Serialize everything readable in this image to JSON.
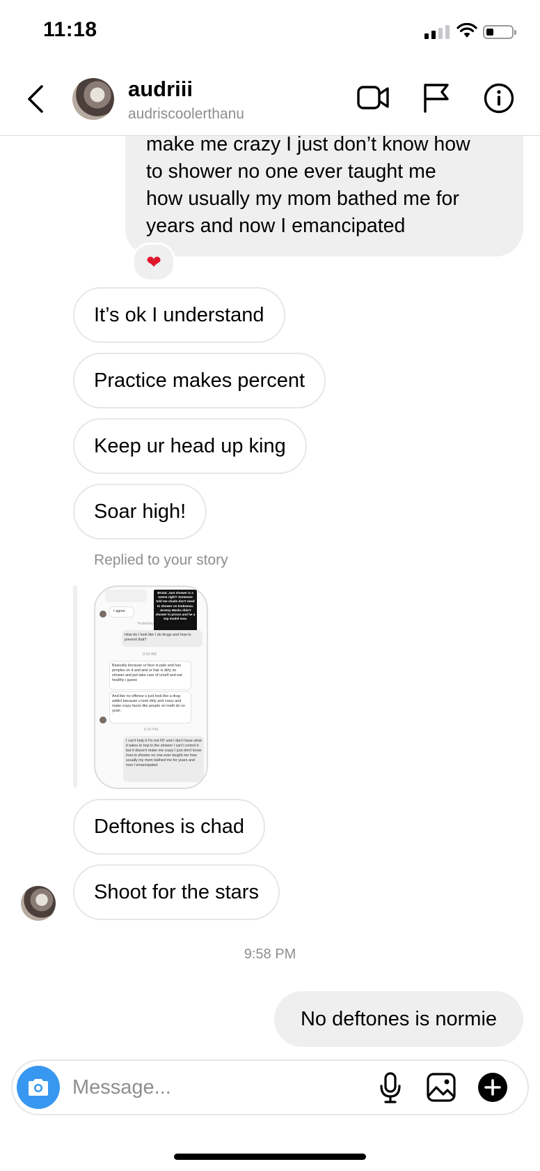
{
  "status_bar": {
    "time": "11:18"
  },
  "header": {
    "username": "audriii",
    "handle": "audriscoolerthanu"
  },
  "messages": {
    "outgoing_long_lines": [
      "make me crazy I just don’t know how",
      "to shower no one ever taught me",
      "how usually my mom bathed me for",
      "years and now I emancipated"
    ],
    "reaction": "❤",
    "incoming_group_1": [
      "It’s ok I understand",
      "Practice makes percent",
      "Keep ur head up king",
      "Soar high!"
    ],
    "story_reply_label": "Replied to your story",
    "incoming_group_2": [
      "Deftones is chad",
      "Shoot for the stars"
    ],
    "timestamp": "9:58 PM",
    "outgoing_last": "No deftones is normie"
  },
  "story_thumbnail": {
    "overlay_text": "Brutal. Just shower is a meme right? Someone told me chads don't need to shower on looksmax. Jeremy Meeks didn't shower in prison and he a top model now.",
    "msg_agree": "I agree",
    "label_yesterday": "Yesterday",
    "msg_drugs": "How do I look like I do drugs and how to prevent that?",
    "time_1": "9:55 AM",
    "msg_pale": "Basically because ur face is pale and has pimples on it and and ur hair is dirty so shower and put take care of urself and eat healthy i guess",
    "msg_offense": "And like no offense u just look like a drug addict because u look dirty and crazy and make crazy faces like people on meth do so yeah",
    "time_2": "6:16 PM",
    "msg_nt": "I can't help it I'm not NT and I don't have what it takes to hop in the shower I can't control it but it doesn't make me crazy I just don't know how to shower no one ever taught me how usually my mom bathed me for years and now I emancipated"
  },
  "composer": {
    "placeholder": "Message..."
  },
  "colors": {
    "accent": "#3897f0",
    "bubble_out": "#efefef",
    "muted_text": "#8e8e8e",
    "heart": "#e0162b"
  },
  "icons": [
    "back-chevron-icon",
    "video-call-icon",
    "flag-icon",
    "info-icon",
    "camera-icon",
    "microphone-icon",
    "gallery-icon",
    "plus-icon",
    "heart-icon",
    "wifi-icon",
    "signal-icon",
    "battery-icon"
  ]
}
